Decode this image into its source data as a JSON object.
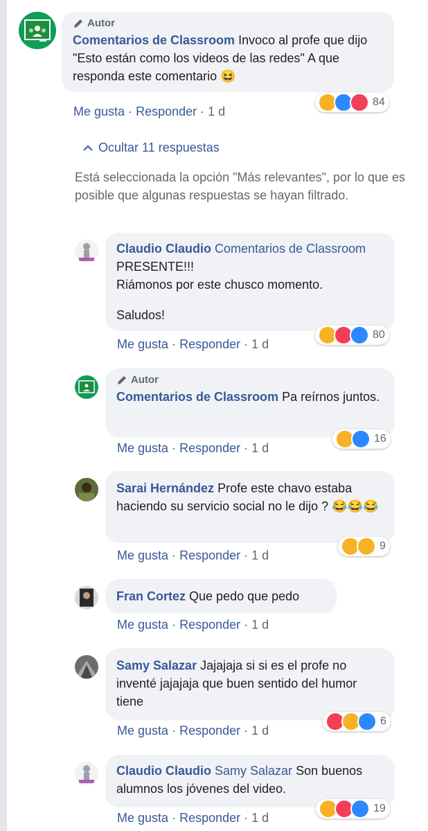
{
  "main_comment": {
    "author_tag": "Autor",
    "author": "Comentarios de Classroom",
    "text": "Invoco al profe que dijo \"Esto están como los videos de las redes\" A que responda este comentario 😆",
    "reaction_count": "84",
    "actions": {
      "like": "Me gusta",
      "reply": "Responder",
      "time": "1 d"
    }
  },
  "replies_toggle": "Ocultar 11 respuestas",
  "relevance_notice": "Está seleccionada la opción \"Más relevantes\", por lo que es posible que algunas respuestas se hayan filtrado.",
  "replies": [
    {
      "author": "Claudio Claudio",
      "mention": "Comentarios de Classroom",
      "line1": "PRESENTE!!!",
      "line2": "Riámonos por este chusco momento.",
      "line3": "Saludos!",
      "reaction_count": "80",
      "actions": {
        "like": "Me gusta",
        "reply": "Responder",
        "time": "1 d"
      }
    },
    {
      "author_tag": "Autor",
      "author": "Comentarios de Classroom",
      "text": "Pa reírnos juntos.",
      "reaction_count": "16",
      "actions": {
        "like": "Me gusta",
        "reply": "Responder",
        "time": "1 d"
      }
    },
    {
      "author": "Sarai Hernández",
      "text": "Profe este chavo estaba haciendo su servicio social no le dijo ? 😂😂😂",
      "reaction_count": "9",
      "actions": {
        "like": "Me gusta",
        "reply": "Responder",
        "time": "1 d"
      }
    },
    {
      "author": "Fran Cortez",
      "text": "Que pedo que pedo",
      "actions": {
        "like": "Me gusta",
        "reply": "Responder",
        "time": "1 d"
      }
    },
    {
      "author": "Samy Salazar",
      "text": "Jajajaja si si es el profe no inventé jajajaja que buen sentido del humor tiene",
      "reaction_count": "6",
      "actions": {
        "like": "Me gusta",
        "reply": "Responder",
        "time": "1 d"
      }
    },
    {
      "author": "Claudio Claudio",
      "mention": "Samy Salazar",
      "text": "Son buenos alumnos los jóvenes del video.",
      "reaction_count": "19",
      "actions": {
        "like": "Me gusta",
        "reply": "Responder",
        "time": "1 d"
      }
    }
  ],
  "sep": "·",
  "colors": {
    "link": "#385898",
    "bubble": "#f0f2f5",
    "meta": "#606770",
    "haha": "#f7b125",
    "like": "#2d88ff",
    "love": "#f33e58"
  }
}
